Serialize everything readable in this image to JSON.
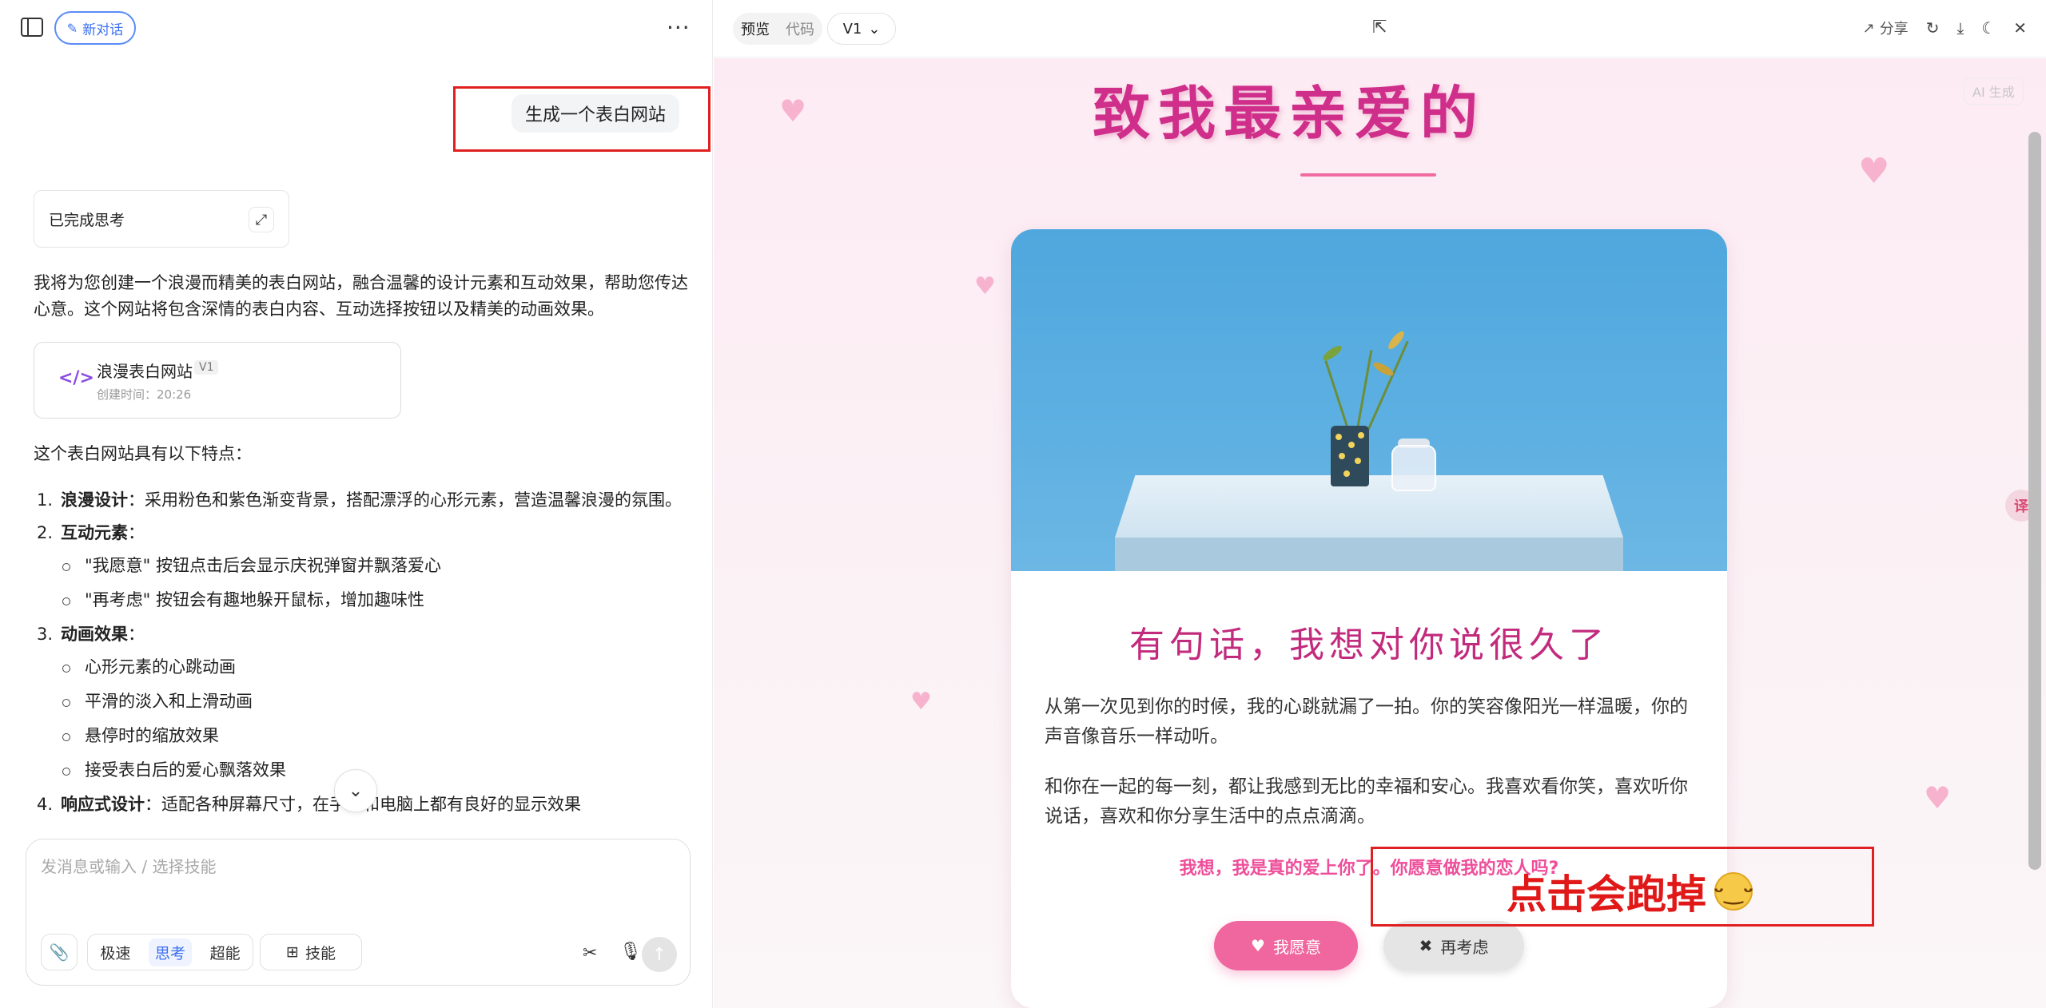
{
  "left": {
    "new_chat_label": "新对话",
    "more": "···",
    "user_message": "生成一个表白网站",
    "thinking_label": "已完成思考",
    "intro": "我将为您创建一个浪漫而精美的表白网站，融合温馨的设计元素和互动效果，帮助您传达心意。这个网站将包含深情的表白内容、互动选择按钮以及精美的动画效果。",
    "artifact": {
      "title": "浪漫表白网站",
      "version": "V1",
      "time": "创建时间：20:26"
    },
    "features_intro": "这个表白网站具有以下特点：",
    "features": [
      {
        "num": "1.",
        "title": "浪漫设计",
        "text": "：采用粉色和紫色渐变背景，搭配漂浮的心形元素，营造温馨浪漫的氛围。",
        "subs": []
      },
      {
        "num": "2.",
        "title": "互动元素",
        "text": "：",
        "subs": [
          "\"我愿意\" 按钮点击后会显示庆祝弹窗并飘落爱心",
          "\"再考虑\" 按钮会有趣地躲开鼠标，增加趣味性"
        ]
      },
      {
        "num": "3.",
        "title": "动画效果",
        "text": "：",
        "subs": [
          "心形元素的心跳动画",
          "平滑的淡入和上滑动画",
          "悬停时的缩放效果",
          "接受表白后的爱心飘落效果"
        ]
      },
      {
        "num": "4.",
        "title": "响应式设计",
        "text": "：适配各种屏幕尺寸，在手机和电脑上都有良好的显示效果",
        "subs": []
      }
    ],
    "input_placeholder": "发消息或输入 / 选择技能",
    "modes": [
      "极速",
      "思考",
      "超能"
    ],
    "skills_label": "技能"
  },
  "right": {
    "tab_preview": "预览",
    "tab_code": "代码",
    "version_select": "V1",
    "share_label": "分享",
    "ai_badge": "AI 生成",
    "page_title": "致我最亲爱的",
    "card_heading": "有句话，我想对你说很久了",
    "paragraph1": "从第一次见到你的时候，我的心跳就漏了一拍。你的笑容像阳光一样温暖，你的声音像音乐一样动听。",
    "paragraph2": "和你在一起的每一刻，都让我感到无比的幸福和安心。我喜欢看你笑，喜欢听你说话，喜欢和你分享生活中的点点滴滴。",
    "question": "我想，我是真的爱上你了。你愿意做我的恋人吗?",
    "btn_yes": "我愿意",
    "btn_no": "再考虑",
    "annotation": "点击会跑掉"
  }
}
